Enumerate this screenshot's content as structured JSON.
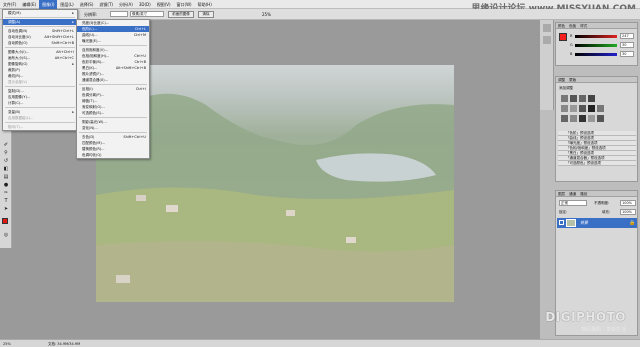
{
  "menubar": {
    "items": [
      "文件(F)",
      "编辑(E)",
      "图像(I)",
      "图层(L)",
      "选择(S)",
      "滤镜(T)",
      "分析(A)",
      "3D(D)",
      "视图(V)",
      "窗口(W)",
      "帮助(H)"
    ],
    "active_index": 2
  },
  "watermark": "思缘设计论坛 www.MISSYUAN.COM",
  "options": {
    "width_label": "宽度:",
    "resolution_label": "分辨率:",
    "unit_value": "像素/英寸",
    "front_image_btn": "前面的图像",
    "clear_btn": "清除",
    "zoom_value": "25%"
  },
  "image_menu": {
    "items": [
      {
        "label": "模式(M)",
        "shortcut": "",
        "arrow": true
      },
      {
        "sep": true
      },
      {
        "label": "调整(A)",
        "shortcut": "",
        "arrow": true,
        "hl": true
      },
      {
        "sep": true
      },
      {
        "label": "自动色调(N)",
        "shortcut": "Shift+Ctrl+L"
      },
      {
        "label": "自动对比度(U)",
        "shortcut": "Alt+Shift+Ctrl+L"
      },
      {
        "label": "自动颜色(O)",
        "shortcut": "Shift+Ctrl+B"
      },
      {
        "sep": true
      },
      {
        "label": "图像大小(I)...",
        "shortcut": "Alt+Ctrl+I"
      },
      {
        "label": "画布大小(S)...",
        "shortcut": "Alt+Ctrl+C"
      },
      {
        "label": "图像旋转(G)",
        "shortcut": "",
        "arrow": true
      },
      {
        "label": "裁剪(P)",
        "shortcut": ""
      },
      {
        "label": "裁切(R)...",
        "shortcut": ""
      },
      {
        "label": "显示全部(V)",
        "shortcut": "",
        "dis": true
      },
      {
        "sep": true
      },
      {
        "label": "复制(D)...",
        "shortcut": ""
      },
      {
        "label": "应用图像(Y)...",
        "shortcut": ""
      },
      {
        "label": "计算(C)...",
        "shortcut": ""
      },
      {
        "sep": true
      },
      {
        "label": "变量(B)",
        "shortcut": "",
        "arrow": true
      },
      {
        "label": "应用数据组(L)...",
        "shortcut": "",
        "dis": true
      },
      {
        "sep": true
      },
      {
        "label": "陷印(T)...",
        "shortcut": "",
        "dis": true
      }
    ]
  },
  "adjust_menu": {
    "items": [
      {
        "label": "亮度/对比度(C)...",
        "shortcut": ""
      },
      {
        "label": "色阶(L)...",
        "shortcut": "Ctrl+L",
        "hl": true
      },
      {
        "label": "曲线(U)...",
        "shortcut": "Ctrl+M"
      },
      {
        "label": "曝光度(E)...",
        "shortcut": ""
      },
      {
        "sep": true
      },
      {
        "label": "自然饱和度(V)...",
        "shortcut": ""
      },
      {
        "label": "色相/饱和度(H)...",
        "shortcut": "Ctrl+U"
      },
      {
        "label": "色彩平衡(B)...",
        "shortcut": "Ctrl+B"
      },
      {
        "label": "黑白(K)...",
        "shortcut": "Alt+Shift+Ctrl+B"
      },
      {
        "label": "照片滤镜(F)...",
        "shortcut": ""
      },
      {
        "label": "通道混合器(X)...",
        "shortcut": ""
      },
      {
        "sep": true
      },
      {
        "label": "反相(I)",
        "shortcut": "Ctrl+I"
      },
      {
        "label": "色调分离(P)...",
        "shortcut": ""
      },
      {
        "label": "阈值(T)...",
        "shortcut": ""
      },
      {
        "label": "渐变映射(G)...",
        "shortcut": ""
      },
      {
        "label": "可选颜色(S)...",
        "shortcut": ""
      },
      {
        "sep": true
      },
      {
        "label": "阴影/高光(W)...",
        "shortcut": ""
      },
      {
        "label": "变化(N)...",
        "shortcut": ""
      },
      {
        "sep": true
      },
      {
        "label": "去色(D)",
        "shortcut": "Shift+Ctrl+U"
      },
      {
        "label": "匹配颜色(M)...",
        "shortcut": ""
      },
      {
        "label": "替换颜色(R)...",
        "shortcut": ""
      },
      {
        "label": "色调均化(Q)",
        "shortcut": ""
      }
    ]
  },
  "color_panel": {
    "tabs": [
      "颜色",
      "色板",
      "样式"
    ],
    "channels": [
      {
        "label": "R",
        "value": "247",
        "color": "#d22"
      },
      {
        "label": "G",
        "value": "30",
        "color": "#2a2"
      },
      {
        "label": "B",
        "value": "30",
        "color": "#22c"
      }
    ]
  },
  "adjust_panel": {
    "tabs": [
      "调整",
      "蒙版"
    ],
    "title": "添加调整",
    "presets": [
      "「色阶」预设选项",
      "「曲线」预设选项",
      "「曝光度」预设选项",
      "「色相/饱和度」预设选项",
      "「黑白」预设选项",
      "「通道混合器」预设选项",
      "「可选颜色」预设选项"
    ]
  },
  "layers_panel": {
    "tabs": [
      "图层",
      "通道",
      "路径"
    ],
    "blend_mode": "正常",
    "opacity_label": "不透明度:",
    "opacity_value": "100%",
    "lock_label": "锁定:",
    "fill_label": "填充:",
    "fill_value": "100%",
    "layer_name": "背景"
  },
  "status": {
    "zoom": "25%",
    "doc": "文档: 34.9M/34.9M"
  },
  "logo": {
    "name": "DIGIPHOTO",
    "sub": "数码摄影 · 享受生活"
  },
  "colors": {
    "accent": "#3a6fc6",
    "foreground": "#e01818",
    "background_swatch": "#ffffff"
  }
}
